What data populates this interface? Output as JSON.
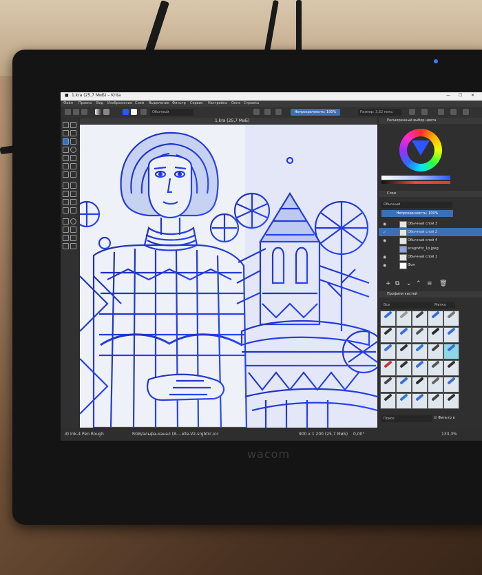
{
  "window": {
    "title": "1.kra (25,7 МиБ)  – Krita",
    "controls": {
      "minimize": "—",
      "maximize": "☐",
      "close": "✕"
    }
  },
  "menubar": {
    "items": [
      "Файл",
      "Правка",
      "Вид",
      "Изображение",
      "Слой",
      "Выделение",
      "Фильтр",
      "Сервис",
      "Настройка",
      "Окно",
      "Справка"
    ]
  },
  "toolbar": {
    "blend_mode": "Обычный",
    "opacity": "Непрозрачность: 100%",
    "size": "Размер: 3,32 пикс."
  },
  "document": {
    "tab_title": "1.kra (25,7 МиБ)"
  },
  "docker": {
    "color_title": "Расширенный выбор цвета",
    "tabs": [
      "Расширенный выб...",
      "Параметры инст..."
    ],
    "layers_title": "Слои",
    "layers_blend": "Обычный",
    "layers_opacity": "Непрозрачность: 100%",
    "layers": [
      {
        "name": "Обычный слой 3",
        "selected": false
      },
      {
        "name": "Обычный слой 2",
        "selected": true
      },
      {
        "name": "Обычный слой 4",
        "selected": false
      },
      {
        "name": "ecagrxttz_1p.jpeg",
        "selected": false
      },
      {
        "name": "Обычный слой 1",
        "selected": false
      },
      {
        "name": "Фон",
        "selected": false
      }
    ],
    "brushes_title": "Профили кистей",
    "brushes_filter": "Все",
    "brushes_tag": "Метка",
    "brush_search_placeholder": "Поиск",
    "brush_filter_checkbox": "Фильтр в"
  },
  "statusbar": {
    "brush": "d) Ink-4 Pen Rough",
    "color_profile": "RGB/альфа-канал (8-...elle-V2-srgbtrc.icc",
    "image_size": "900 x 1 200 (25,7 МиБ)",
    "rotation": "0,00°",
    "zoom": "133,3%"
  },
  "device": {
    "brand": "wacom"
  },
  "colors": {
    "accent": "#3d6fb5",
    "ink": "#2c3fd8",
    "canvas": "#eef1f8"
  }
}
